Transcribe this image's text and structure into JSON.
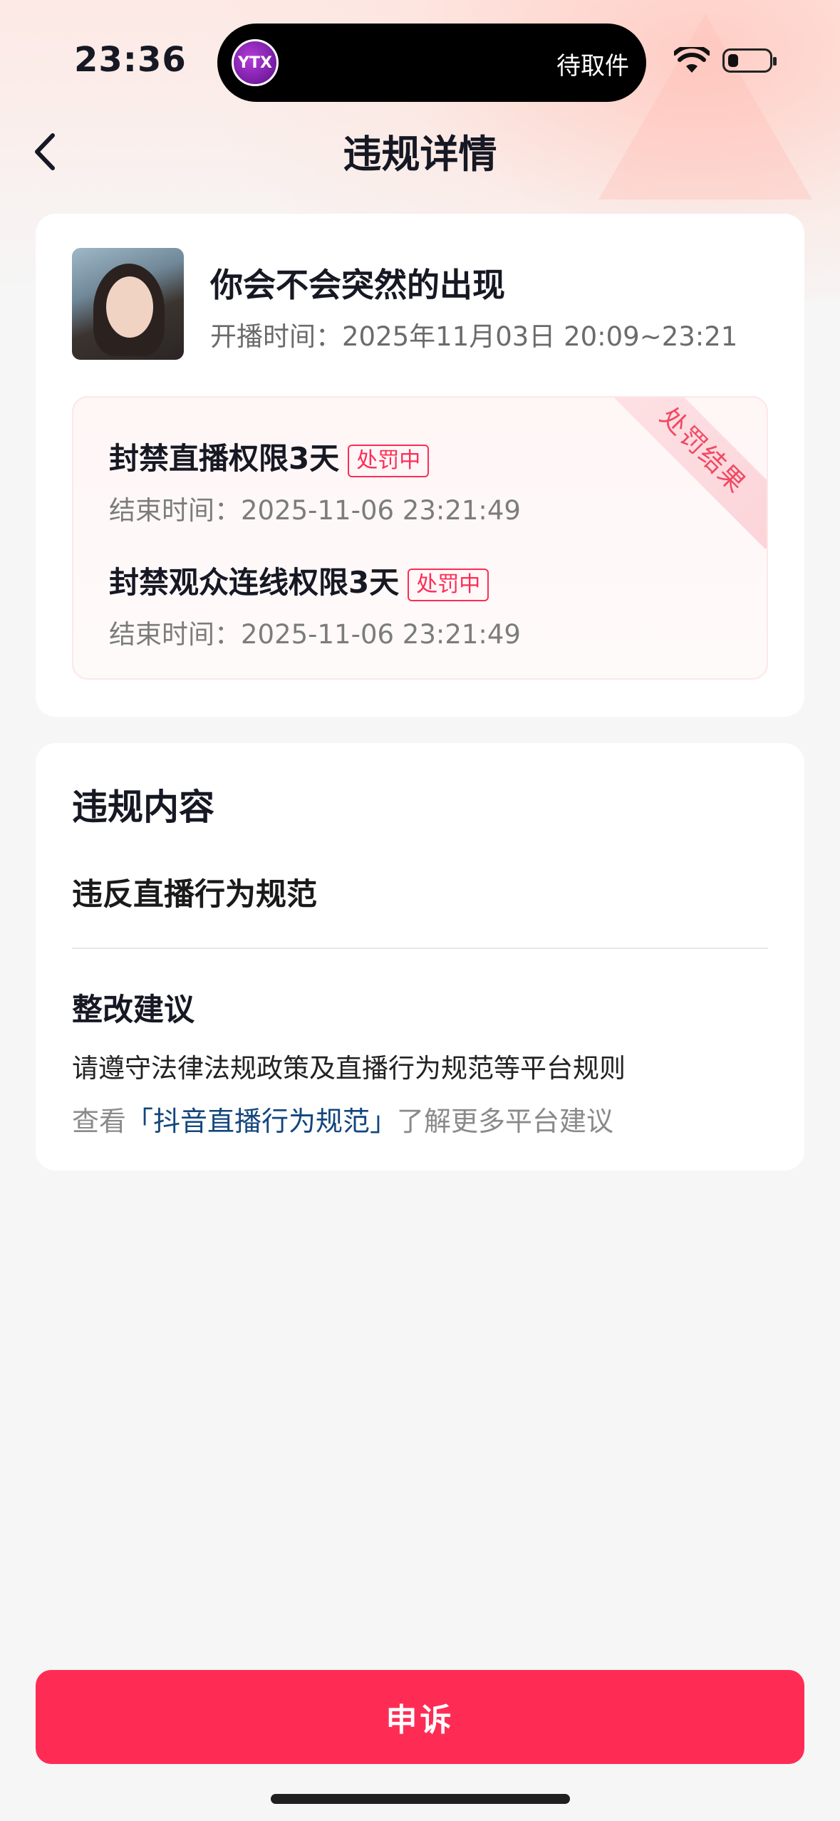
{
  "status_bar": {
    "time": "23:36",
    "island_logo": "YTX",
    "island_text": "待取件"
  },
  "header": {
    "title": "违规详情"
  },
  "stream": {
    "title": "你会不会突然的出现",
    "time": "开播时间：2025年11月03日 20:09~23:21"
  },
  "penalties": {
    "ribbon": "处罚结果",
    "items": [
      {
        "title": "封禁直播权限3天",
        "badge": "处罚中",
        "end_time": "结束时间：2025-11-06 23:21:49"
      },
      {
        "title": "封禁观众连线权限3天",
        "badge": "处罚中",
        "end_time": "结束时间：2025-11-06 23:21:49"
      }
    ]
  },
  "violation": {
    "section_title": "违规内容",
    "content": "违反直播行为规范",
    "advice_title": "整改建议",
    "advice_text": "请遵守法律法规政策及直播行为规范等平台规则",
    "more_prefix": "查看",
    "more_link": "「抖音直播行为规范」",
    "more_suffix": "了解更多平台建议"
  },
  "footer": {
    "appeal_label": "申诉"
  },
  "colors": {
    "accent": "#fe2c55",
    "link": "#13467d"
  }
}
